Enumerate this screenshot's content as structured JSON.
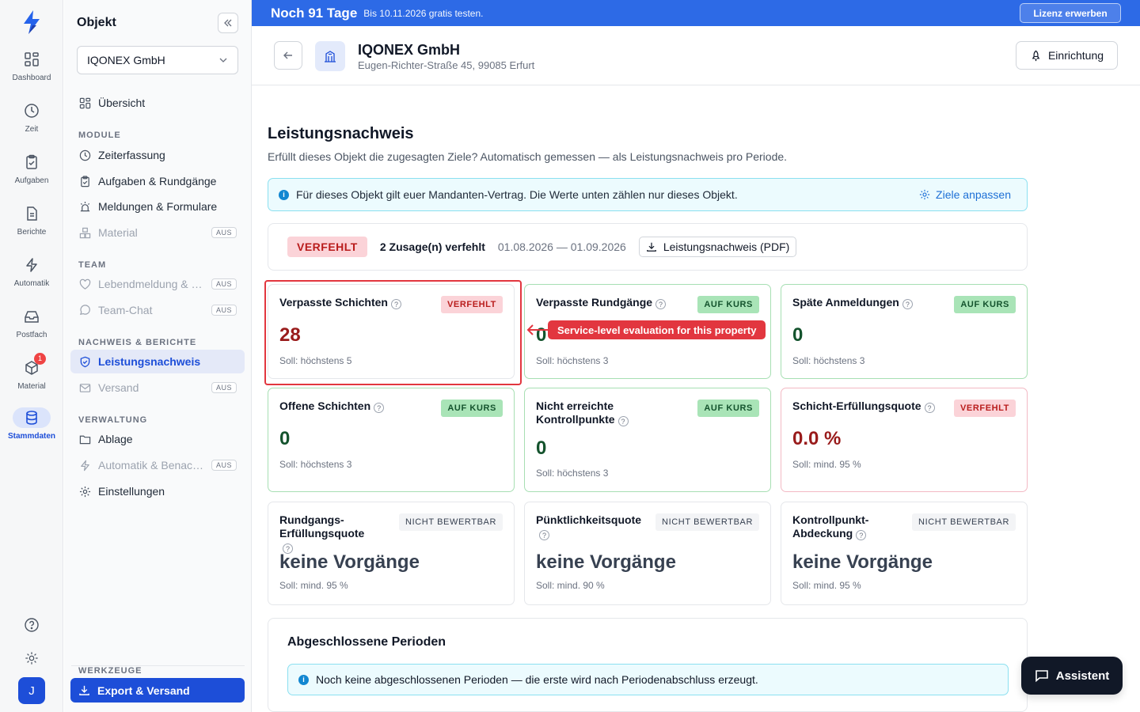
{
  "rail": {
    "items": [
      {
        "label": "Dashboard"
      },
      {
        "label": "Zeit"
      },
      {
        "label": "Aufgaben"
      },
      {
        "label": "Berichte"
      },
      {
        "label": "Automatik"
      },
      {
        "label": "Postfach"
      },
      {
        "label": "Material",
        "badge": "1"
      },
      {
        "label": "Stammdaten"
      }
    ],
    "avatar": "J"
  },
  "sidebar": {
    "title": "Objekt",
    "object_select": "IQONEX GmbH",
    "overview": "Übersicht",
    "sections": {
      "module": "MODULE",
      "team": "TEAM",
      "nachweis": "NACHWEIS & BERICHTE",
      "verwaltung": "VERWALTUNG",
      "werkzeuge": "WERKZEUGE"
    },
    "items": {
      "zeiterfassung": "Zeiterfassung",
      "aufgaben": "Aufgaben & Rundgänge",
      "meldungen": "Meldungen & Formulare",
      "material": "Material",
      "lebend": "Lebendmeldung & …",
      "teamchat": "Team-Chat",
      "leistung": "Leistungsnachweis",
      "versand": "Versand",
      "ablage": "Ablage",
      "automatik": "Automatik & Benac…",
      "einstellungen": "Einstellungen"
    },
    "aus": "AUS",
    "export": "Export & Versand"
  },
  "banner": {
    "days": "Noch 91 Tage",
    "text": "Bis 10.11.2026 gratis testen.",
    "license": "Lizenz erwerben"
  },
  "header": {
    "title": "IQONEX GmbH",
    "address": "Eugen-Richter-Straße 45, 99085 Erfurt",
    "setup": "Einrichtung"
  },
  "page": {
    "title": "Leistungsnachweis",
    "description": "Erfüllt dieses Objekt die zugesagten Ziele? Automatisch gemessen — als Leistungsnachweis pro Periode.",
    "info": "Für dieses Objekt gilt euer Mandanten-Vertrag. Die Werte unten zählen nur dieses Objekt.",
    "info_link": "Ziele anpassen"
  },
  "status": {
    "badge": "VERFEHLT",
    "summary": "2 Zusage(n) verfehlt",
    "period": "01.08.2026 — 01.09.2026",
    "pdf": "Leistungsnachweis (PDF)"
  },
  "cards": [
    {
      "title": "Verpasste Schichten",
      "badge": "VERFEHLT",
      "value": "28",
      "soll": "Soll: höchstens 5"
    },
    {
      "title": "Verpasste Rundgänge",
      "badge": "AUF KURS",
      "value": "0",
      "soll": "Soll: höchstens 3"
    },
    {
      "title": "Späte Anmeldungen",
      "badge": "AUF KURS",
      "value": "0",
      "soll": "Soll: höchstens 3"
    },
    {
      "title": "Offene Schichten",
      "badge": "AUF KURS",
      "value": "0",
      "soll": "Soll: höchstens 3"
    },
    {
      "title": "Nicht erreichte Kontrollpunkte",
      "badge": "AUF KURS",
      "value": "0",
      "soll": "Soll: höchstens 3"
    },
    {
      "title": "Schicht-Erfüllungsquote",
      "badge": "VERFEHLT",
      "value": "0.0 %",
      "soll": "Soll: mind. 95 %"
    },
    {
      "title": "Rundgangs-Erfüllungsquote",
      "badge": "NICHT BEWERTBAR",
      "value": "keine Vorgänge",
      "soll": "Soll: mind. 95 %"
    },
    {
      "title": "Pünktlichkeitsquote",
      "badge": "NICHT BEWERTBAR",
      "value": "keine Vorgänge",
      "soll": "Soll: mind. 90 %"
    },
    {
      "title": "Kontrollpunkt-Abdeckung",
      "badge": "NICHT BEWERTBAR",
      "value": "keine Vorgänge",
      "soll": "Soll: mind. 95 %"
    }
  ],
  "tooltip": "Service-level evaluation for this property",
  "periods": {
    "title": "Abgeschlossene Perioden",
    "info": "Noch keine abgeschlossenen Perioden — die erste wird nach Periodenabschluss erzeugt."
  },
  "assistant": "Assistent",
  "colors": {
    "accent": "#1d4ed8",
    "banner": "#2d6ae6",
    "ok": "#14532d",
    "bad": "#b91c1c",
    "highlight": "#e2363f"
  }
}
